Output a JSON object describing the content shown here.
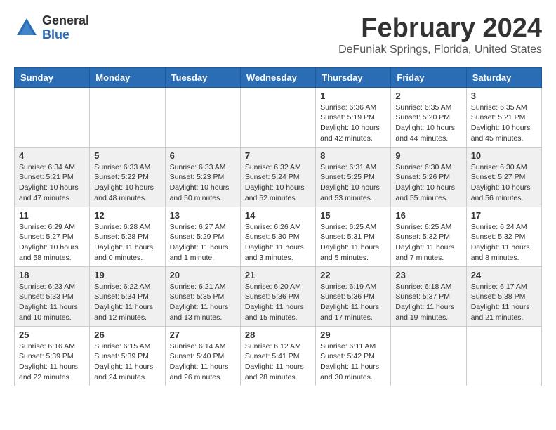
{
  "logo": {
    "general": "General",
    "blue": "Blue"
  },
  "title": "February 2024",
  "subtitle": "DeFuniak Springs, Florida, United States",
  "headers": [
    "Sunday",
    "Monday",
    "Tuesday",
    "Wednesday",
    "Thursday",
    "Friday",
    "Saturday"
  ],
  "weeks": [
    [
      {
        "day": "",
        "info": ""
      },
      {
        "day": "",
        "info": ""
      },
      {
        "day": "",
        "info": ""
      },
      {
        "day": "",
        "info": ""
      },
      {
        "day": "1",
        "info": "Sunrise: 6:36 AM\nSunset: 5:19 PM\nDaylight: 10 hours\nand 42 minutes."
      },
      {
        "day": "2",
        "info": "Sunrise: 6:35 AM\nSunset: 5:20 PM\nDaylight: 10 hours\nand 44 minutes."
      },
      {
        "day": "3",
        "info": "Sunrise: 6:35 AM\nSunset: 5:21 PM\nDaylight: 10 hours\nand 45 minutes."
      }
    ],
    [
      {
        "day": "4",
        "info": "Sunrise: 6:34 AM\nSunset: 5:21 PM\nDaylight: 10 hours\nand 47 minutes."
      },
      {
        "day": "5",
        "info": "Sunrise: 6:33 AM\nSunset: 5:22 PM\nDaylight: 10 hours\nand 48 minutes."
      },
      {
        "day": "6",
        "info": "Sunrise: 6:33 AM\nSunset: 5:23 PM\nDaylight: 10 hours\nand 50 minutes."
      },
      {
        "day": "7",
        "info": "Sunrise: 6:32 AM\nSunset: 5:24 PM\nDaylight: 10 hours\nand 52 minutes."
      },
      {
        "day": "8",
        "info": "Sunrise: 6:31 AM\nSunset: 5:25 PM\nDaylight: 10 hours\nand 53 minutes."
      },
      {
        "day": "9",
        "info": "Sunrise: 6:30 AM\nSunset: 5:26 PM\nDaylight: 10 hours\nand 55 minutes."
      },
      {
        "day": "10",
        "info": "Sunrise: 6:30 AM\nSunset: 5:27 PM\nDaylight: 10 hours\nand 56 minutes."
      }
    ],
    [
      {
        "day": "11",
        "info": "Sunrise: 6:29 AM\nSunset: 5:27 PM\nDaylight: 10 hours\nand 58 minutes."
      },
      {
        "day": "12",
        "info": "Sunrise: 6:28 AM\nSunset: 5:28 PM\nDaylight: 11 hours\nand 0 minutes."
      },
      {
        "day": "13",
        "info": "Sunrise: 6:27 AM\nSunset: 5:29 PM\nDaylight: 11 hours\nand 1 minute."
      },
      {
        "day": "14",
        "info": "Sunrise: 6:26 AM\nSunset: 5:30 PM\nDaylight: 11 hours\nand 3 minutes."
      },
      {
        "day": "15",
        "info": "Sunrise: 6:25 AM\nSunset: 5:31 PM\nDaylight: 11 hours\nand 5 minutes."
      },
      {
        "day": "16",
        "info": "Sunrise: 6:25 AM\nSunset: 5:32 PM\nDaylight: 11 hours\nand 7 minutes."
      },
      {
        "day": "17",
        "info": "Sunrise: 6:24 AM\nSunset: 5:32 PM\nDaylight: 11 hours\nand 8 minutes."
      }
    ],
    [
      {
        "day": "18",
        "info": "Sunrise: 6:23 AM\nSunset: 5:33 PM\nDaylight: 11 hours\nand 10 minutes."
      },
      {
        "day": "19",
        "info": "Sunrise: 6:22 AM\nSunset: 5:34 PM\nDaylight: 11 hours\nand 12 minutes."
      },
      {
        "day": "20",
        "info": "Sunrise: 6:21 AM\nSunset: 5:35 PM\nDaylight: 11 hours\nand 13 minutes."
      },
      {
        "day": "21",
        "info": "Sunrise: 6:20 AM\nSunset: 5:36 PM\nDaylight: 11 hours\nand 15 minutes."
      },
      {
        "day": "22",
        "info": "Sunrise: 6:19 AM\nSunset: 5:36 PM\nDaylight: 11 hours\nand 17 minutes."
      },
      {
        "day": "23",
        "info": "Sunrise: 6:18 AM\nSunset: 5:37 PM\nDaylight: 11 hours\nand 19 minutes."
      },
      {
        "day": "24",
        "info": "Sunrise: 6:17 AM\nSunset: 5:38 PM\nDaylight: 11 hours\nand 21 minutes."
      }
    ],
    [
      {
        "day": "25",
        "info": "Sunrise: 6:16 AM\nSunset: 5:39 PM\nDaylight: 11 hours\nand 22 minutes."
      },
      {
        "day": "26",
        "info": "Sunrise: 6:15 AM\nSunset: 5:39 PM\nDaylight: 11 hours\nand 24 minutes."
      },
      {
        "day": "27",
        "info": "Sunrise: 6:14 AM\nSunset: 5:40 PM\nDaylight: 11 hours\nand 26 minutes."
      },
      {
        "day": "28",
        "info": "Sunrise: 6:12 AM\nSunset: 5:41 PM\nDaylight: 11 hours\nand 28 minutes."
      },
      {
        "day": "29",
        "info": "Sunrise: 6:11 AM\nSunset: 5:42 PM\nDaylight: 11 hours\nand 30 minutes."
      },
      {
        "day": "",
        "info": ""
      },
      {
        "day": "",
        "info": ""
      }
    ]
  ]
}
